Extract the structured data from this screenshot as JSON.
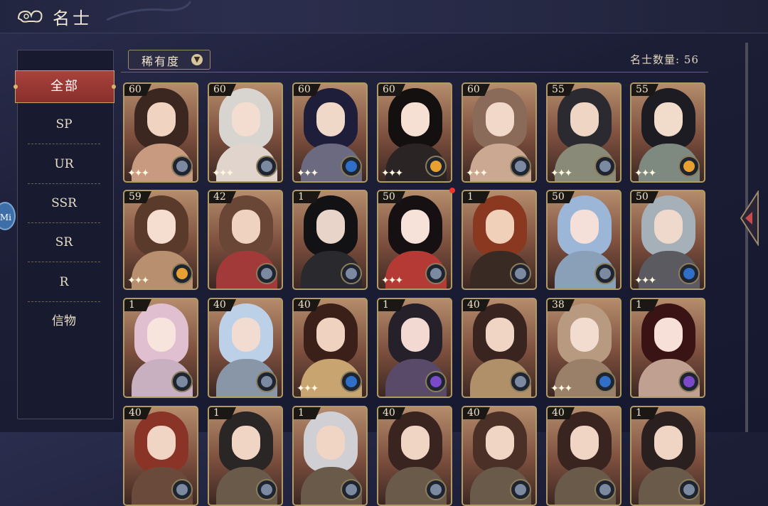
{
  "header": {
    "title": "名士"
  },
  "sidebar": {
    "active": "全部",
    "items": [
      "SP",
      "UR",
      "SSR",
      "SR",
      "R",
      "信物"
    ]
  },
  "left_tab": {
    "label": "Mi"
  },
  "filter": {
    "label": "稀有度"
  },
  "count": {
    "text": "名士数量: 56"
  },
  "colors": {
    "active_tab": "#a8423c",
    "gold_border": "#b29a64",
    "notify": "#ee3333"
  },
  "cards": [
    {
      "level": "60",
      "hair": "#3b2620",
      "face": "#f0d3c0",
      "body": "#c89b80",
      "badge": "grey",
      "sparkles": true
    },
    {
      "level": "60",
      "hair": "#d8d4d0",
      "face": "#f3ddd0",
      "body": "#e0d4cc",
      "badge": "grey",
      "sparkles": true
    },
    {
      "level": "60",
      "hair": "#1e1e3a",
      "face": "#f0d8c8",
      "body": "#6b6a80",
      "badge": "blue",
      "sparkles": true
    },
    {
      "level": "60",
      "hair": "#141010",
      "face": "#f6e0d4",
      "body": "#2a2424",
      "badge": "orange",
      "sparkles": true
    },
    {
      "level": "60",
      "hair": "#8a6a58",
      "face": "#f2d8c8",
      "body": "#caa892",
      "badge": "grey",
      "sparkles": true
    },
    {
      "level": "55",
      "hair": "#2a2a30",
      "face": "#efd6c4",
      "body": "#8a8a78",
      "badge": "grey",
      "sparkles": true
    },
    {
      "level": "55",
      "hair": "#1c1c22",
      "face": "#f1dccc",
      "body": "#7e8a80",
      "badge": "orange",
      "sparkles": true
    },
    {
      "level": "59",
      "hair": "#5a3a2a",
      "face": "#f5ddd0",
      "body": "#b89070",
      "badge": "orange",
      "sparkles": true
    },
    {
      "level": "42",
      "hair": "#6a4636",
      "face": "#efd2c0",
      "body": "#a23a3a",
      "badge": "grey",
      "sparkles": false
    },
    {
      "level": "1",
      "hair": "#121214",
      "face": "#e8d4c8",
      "body": "#2a2a2e",
      "badge": "grey",
      "sparkles": false
    },
    {
      "level": "50",
      "hair": "#161012",
      "face": "#f6e2d8",
      "body": "#b53a36",
      "badge": "grey",
      "sparkles": true
    },
    {
      "level": "1",
      "hair": "#8a3820",
      "face": "#f0d0b8",
      "body": "#3a2a24",
      "badge": "grey",
      "sparkles": false
    },
    {
      "level": "50",
      "hair": "#9cb6d8",
      "face": "#f4e0d8",
      "body": "#8aa0b8",
      "badge": "grey",
      "sparkles": false
    },
    {
      "level": "50",
      "hair": "#a6b0b8",
      "face": "#efd8cc",
      "body": "#5a5a60",
      "badge": "blue",
      "sparkles": true
    },
    {
      "level": "1",
      "hair": "#e0c0d0",
      "face": "#f7e4dc",
      "body": "#c8b0c0",
      "badge": "grey",
      "sparkles": false
    },
    {
      "level": "40",
      "hair": "#bcd0e8",
      "face": "#f2dcd2",
      "body": "#8896a8",
      "badge": "grey",
      "sparkles": false
    },
    {
      "level": "40",
      "hair": "#3a2018",
      "face": "#f0d2c0",
      "body": "#c8a470",
      "badge": "blue",
      "sparkles": true
    },
    {
      "level": "1",
      "hair": "#26202a",
      "face": "#f2dad2",
      "body": "#5a4a6a",
      "badge": "purple",
      "sparkles": false
    },
    {
      "level": "40",
      "hair": "#3a2420",
      "face": "#f0d4c4",
      "body": "#b09068",
      "badge": "grey",
      "sparkles": false
    },
    {
      "level": "38",
      "hair": "#b89a80",
      "face": "#f2dcd0",
      "body": "#9a8068",
      "badge": "blue",
      "sparkles": true
    },
    {
      "level": "1",
      "hair": "#3a1414",
      "face": "#f6e0d8",
      "body": "#c0a090",
      "badge": "purple",
      "sparkles": false
    },
    {
      "level": "40",
      "hair": "#8a3428",
      "face": "#f0d4c4",
      "body": "#6a4a3a",
      "badge": "grey",
      "sparkles": false
    },
    {
      "level": "1",
      "hair": "#2a2626",
      "face": "#f0d4c4",
      "body": "#6a5a4a",
      "badge": "grey",
      "sparkles": false
    },
    {
      "level": "1",
      "hair": "#d0d0d4",
      "face": "#f0d4c4",
      "body": "#6a5a4a",
      "badge": "grey",
      "sparkles": false
    },
    {
      "level": "40",
      "hair": "#3a2420",
      "face": "#f0d4c4",
      "body": "#6a5a4a",
      "badge": "grey",
      "sparkles": false
    },
    {
      "level": "40",
      "hair": "#4a3026",
      "face": "#f0d4c4",
      "body": "#6a5a4a",
      "badge": "grey",
      "sparkles": false
    },
    {
      "level": "40",
      "hair": "#3a2420",
      "face": "#f0d4c4",
      "body": "#6a5a4a",
      "badge": "grey",
      "sparkles": false
    },
    {
      "level": "1",
      "hair": "#2a2020",
      "face": "#f0d4c4",
      "body": "#6a5a4a",
      "badge": "grey",
      "sparkles": false
    }
  ]
}
